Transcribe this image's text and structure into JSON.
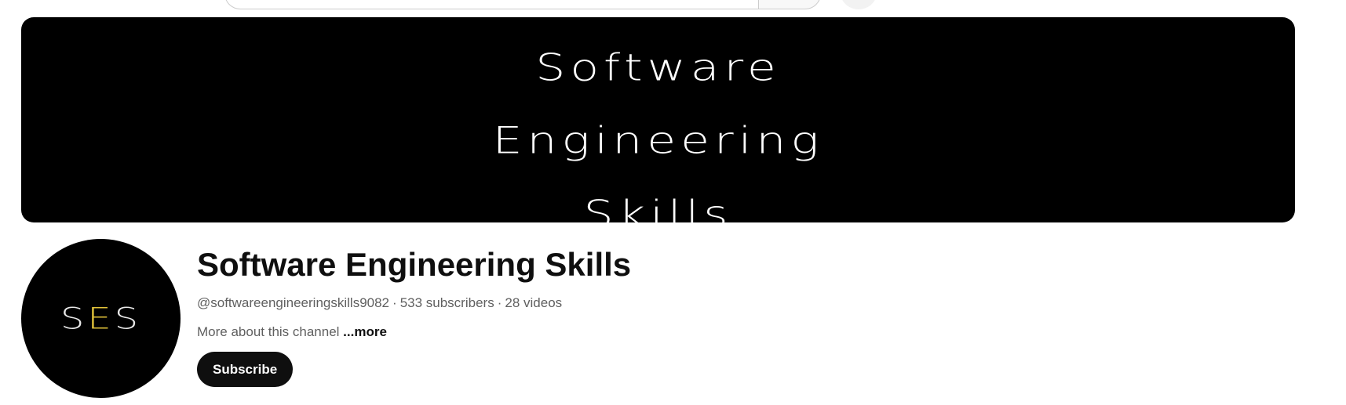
{
  "banner": {
    "lines": [
      "Software",
      "Engineering",
      "Skills"
    ]
  },
  "avatar": {
    "initials_prefix": "S",
    "initials_accent": "E",
    "initials_suffix": "S",
    "accent_color": "#e2c33a"
  },
  "channel": {
    "title": "Software Engineering Skills",
    "handle": "@softwareengineeringskills9082",
    "separator": "·",
    "subscribers": "533 subscribers",
    "videos": "28 videos",
    "description": "More about this channel ",
    "more_label": "...more"
  },
  "actions": {
    "subscribe_label": "Subscribe"
  }
}
